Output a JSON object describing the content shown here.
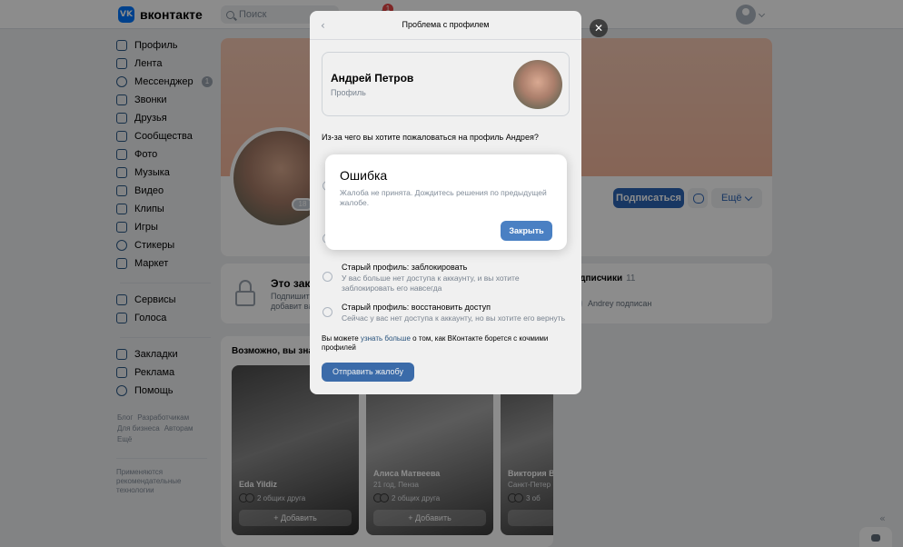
{
  "header": {
    "logo_mark": "VK",
    "logo_text": "вконтакте",
    "search_placeholder": "Поиск",
    "notifications_count": "1"
  },
  "sidebar": {
    "items": [
      {
        "label": "Профиль",
        "icon": "user-icon"
      },
      {
        "label": "Лента",
        "icon": "news-icon"
      },
      {
        "label": "Мессенджер",
        "icon": "message-icon",
        "badge": "1"
      },
      {
        "label": "Звонки",
        "icon": "phone-icon"
      },
      {
        "label": "Друзья",
        "icon": "friends-icon"
      },
      {
        "label": "Сообщества",
        "icon": "groups-icon"
      },
      {
        "label": "Фото",
        "icon": "photo-icon"
      },
      {
        "label": "Музыка",
        "icon": "music-icon"
      },
      {
        "label": "Видео",
        "icon": "video-icon"
      },
      {
        "label": "Клипы",
        "icon": "clips-icon"
      },
      {
        "label": "Игры",
        "icon": "games-icon"
      },
      {
        "label": "Стикеры",
        "icon": "stickers-icon"
      },
      {
        "label": "Маркет",
        "icon": "market-icon"
      }
    ],
    "items2": [
      {
        "label": "Сервисы",
        "icon": "services-icon"
      },
      {
        "label": "Голоса",
        "icon": "votes-icon"
      }
    ],
    "items3": [
      {
        "label": "Закладки",
        "icon": "bookmark-icon"
      },
      {
        "label": "Реклама",
        "icon": "ads-icon"
      },
      {
        "label": "Помощь",
        "icon": "help-icon"
      }
    ],
    "footer_links": [
      "Блог",
      "Разработчикам",
      "Для бизнеса",
      "Авторам",
      "Ещё"
    ],
    "footer_note": "Применяются рекомендательные технологии"
  },
  "profile": {
    "subscribe": "Подписаться",
    "more": "Ещё",
    "avatar_badge": "18"
  },
  "closed": {
    "title": "Это закр",
    "desc1": "Подпишит",
    "desc2": "добавит вам"
  },
  "subscribers": {
    "title": "Подписчики",
    "count": "11",
    "row": "Andrey подписан"
  },
  "friends": {
    "title": "Возможно, вы знак",
    "cards": [
      {
        "name": "Eda Yildiz",
        "sub": "",
        "mutual": "2 общих друга",
        "add": "Добавить"
      },
      {
        "name": "Алиса Матвеева",
        "sub": "21 год, Пенза",
        "mutual": "2 общих друга",
        "add": "Добавить"
      },
      {
        "name": "Виктория В",
        "sub": "Санкт-Петер",
        "mutual": "3 об",
        "add": "Д"
      }
    ]
  },
  "report": {
    "title": "Проблема с профилем",
    "name": "Андрей Петров",
    "label": "Профиль",
    "question": "Из-за чего вы хотите пожаловаться на профиль Андрея?",
    "options": [
      {
        "title": "Старый профиль: заблокировать",
        "desc": "У вас больше нет доступа к аккаунту, и вы хотите заблокировать его навсегда"
      },
      {
        "title": "Старый профиль: восстановить доступ",
        "desc": "Сейчас у вас нет доступа к аккаунту, но вы хотите его вернуть"
      }
    ],
    "learn_pre": "Вы можете ",
    "learn_link": "узнать больше",
    "learn_post": " о том, как ВКонтакте борется с кочмими профилей",
    "send": "Отправить жалобу"
  },
  "error": {
    "title": "Ошибка",
    "text": "Жалоба не принята. Дождитесь решения по предыдущей жалобе.",
    "close": "Закрыть"
  },
  "colors": {
    "accent": "#2d64b4",
    "link": "#2a5885",
    "background": "#edeef0"
  }
}
